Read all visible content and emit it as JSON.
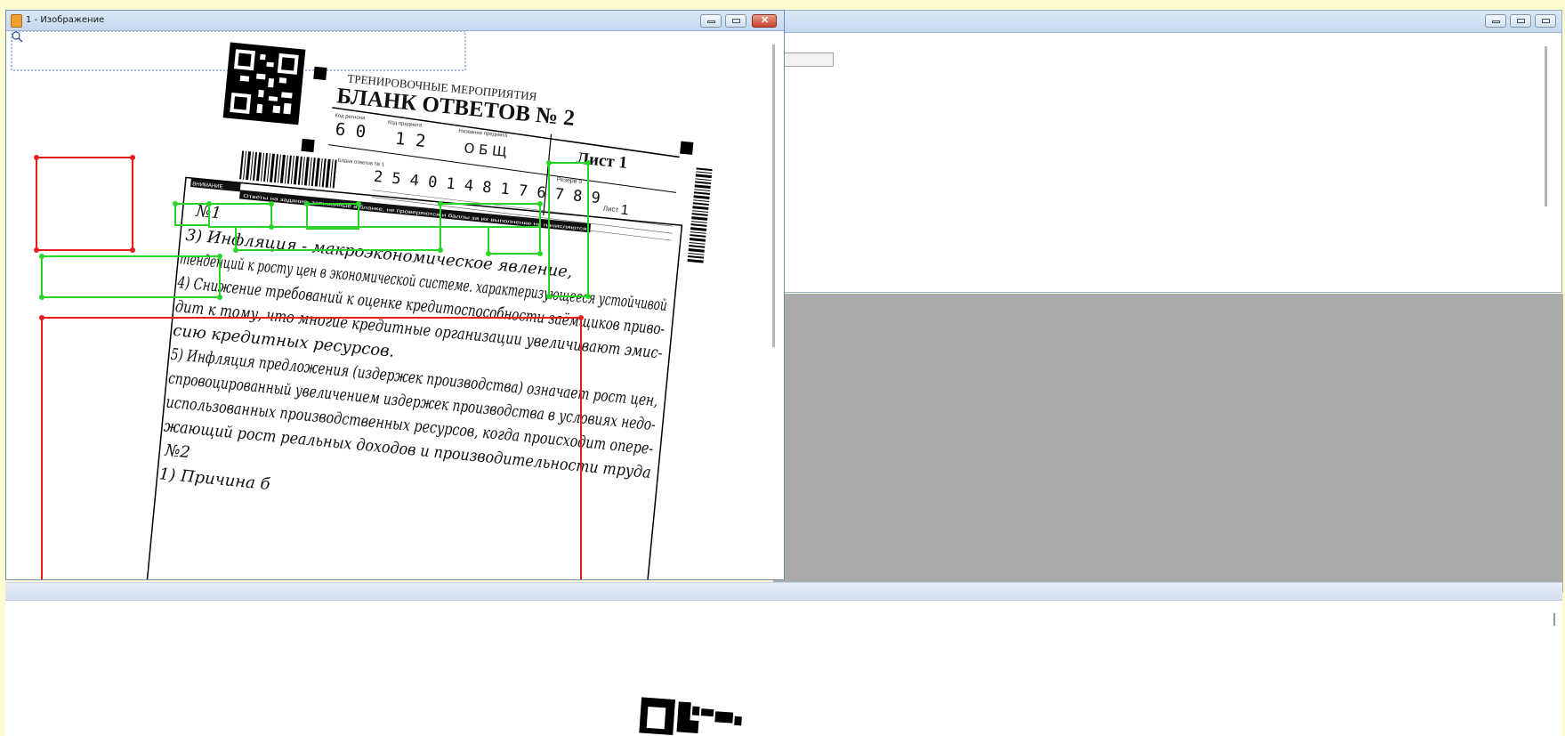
{
  "image_window": {
    "title": "1 - Изображение",
    "controls": {
      "minimize": "minimize-icon",
      "restore": "restore-icon",
      "close": "✕"
    },
    "zoom_icon": "magnifier-icon"
  },
  "form": {
    "header_top": "ТРЕНИРОВОЧНЫЕ МЕРОПРИЯТИЯ",
    "title": "БЛАНК ОТВЕТОВ № 2",
    "region_label": "Код региона",
    "region_value": "6 0",
    "subject_label": "Код предмета",
    "subject_value": "1 2",
    "subject_name_label": "Название предмета",
    "subject_name_value": "О Б Щ",
    "sheet_label": "Лист 1",
    "reserve_label": "Резерв 5",
    "barcode_label": "Бланк ответов № 1",
    "barcode_number": "2 5 4 0 1 4 8 1 7 6 7 8 9",
    "sheet_small": "Лист",
    "sheet_small_num": "1",
    "warning_bar": "Ответы на задания, записанные в бланке, не проверяются и баллы за их выполнение не начисляются",
    "dark_label": "ВНИМАНИЕ",
    "handwriting": [
      "№1",
      "3) Инфляция - макроэкономическое явление,",
      "тенденций к росту цен в экономической системе. характеризующееся устойчивой",
      "4) Снижение требований к оценке кредитоспособности заёмщиков приво-",
      "дит к тому, что многие кредитные организации увеличивают эмис-",
      "сию кредитных ресурсов.",
      "5) Инфляция предложения (издержек производства) означает рост цен,",
      "спровоцированный увеличением издержек производства в условиях недо-",
      "использованных производственных ресурсов, когда происходит опере-",
      "жающий рост реальных доходов и производительности труда",
      "№2",
      "1) Причина б"
    ]
  },
  "colors": {
    "selection_red": "#e81e1e",
    "selection_green": "#27d627",
    "background_yellow": "#fdfcd0",
    "panel_gray": "#ababab"
  }
}
